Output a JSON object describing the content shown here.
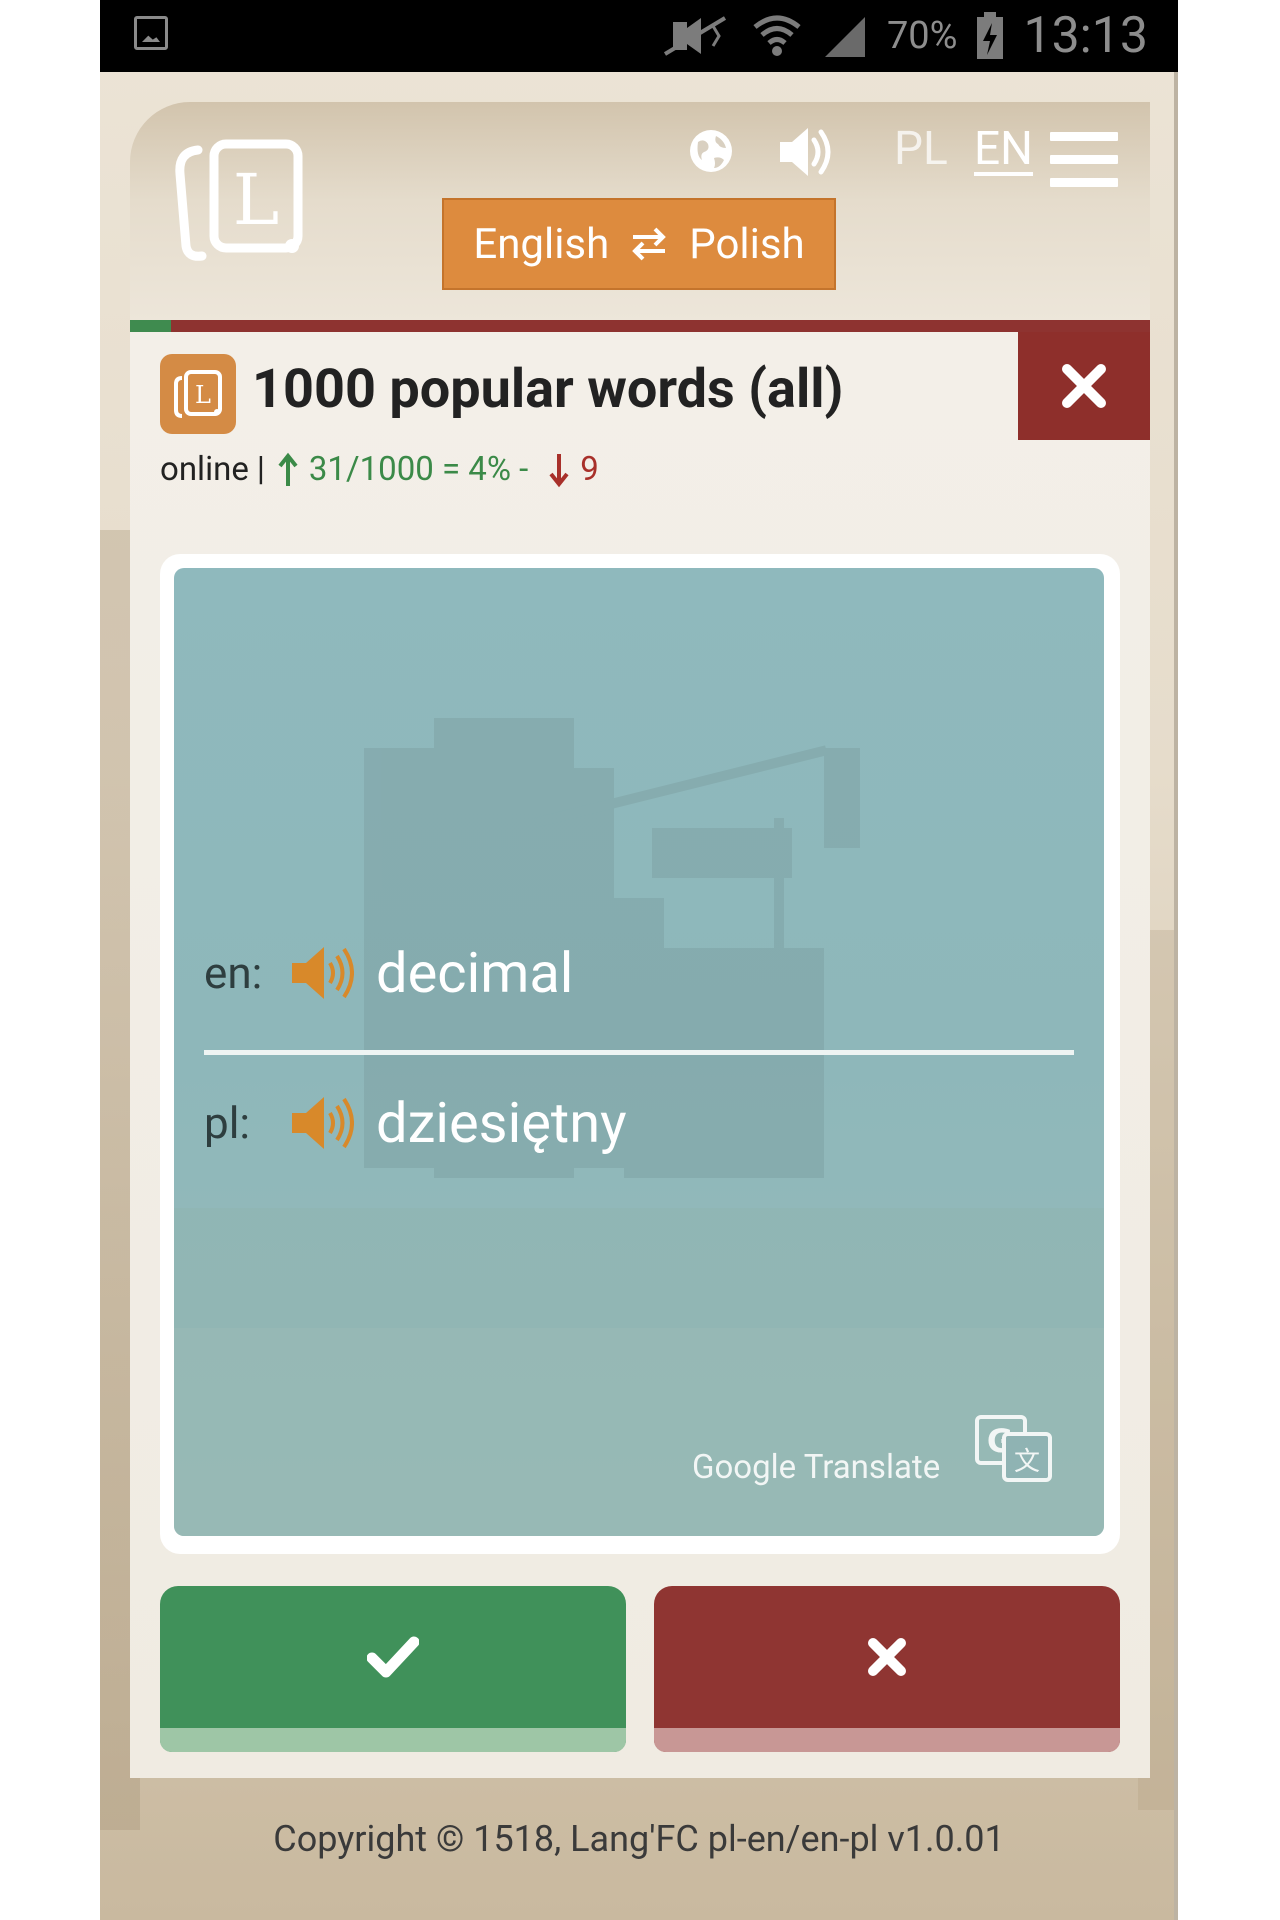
{
  "status_bar": {
    "battery": "70%",
    "time": "13:13"
  },
  "header": {
    "lang_pl": "PL",
    "lang_en": "EN",
    "switch": {
      "from": "English",
      "to": "Polish",
      "icon": "swap-arrows-icon"
    }
  },
  "progress": {
    "fraction": 0.04
  },
  "deck": {
    "title": "1000 popular words (all)",
    "mode": "online",
    "separator": "|",
    "known_stat": "31/1000 = 4% -",
    "wrong_count": "9"
  },
  "card": {
    "rows": [
      {
        "label": "en:",
        "word": "decimal"
      },
      {
        "label": "pl:",
        "word": "dziesiętny"
      }
    ],
    "translate_label": "Google Translate"
  },
  "actions": {
    "correct_icon": "check-icon",
    "wrong_icon": "close-icon"
  },
  "footer": "Copyright © 1518, Lang'FC pl-en/en-pl v1.0.01",
  "colors": {
    "accent_orange": "#dd8b3e",
    "correct_green": "#40915a",
    "wrong_red": "#8f3532",
    "card_teal": "#8fb9bd"
  }
}
